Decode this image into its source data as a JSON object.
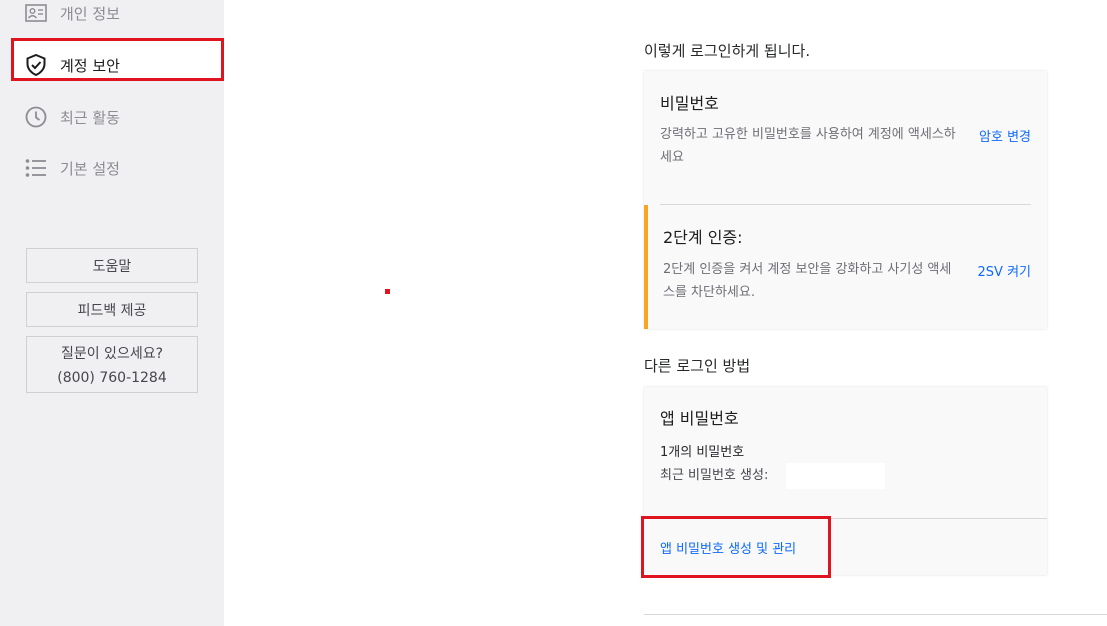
{
  "sidebar": {
    "items": [
      {
        "label": "개인 정보",
        "icon": "id-card-icon"
      },
      {
        "label": "계정 보안",
        "icon": "shield-check-icon",
        "active": true
      },
      {
        "label": "최근 활동",
        "icon": "clock-icon"
      },
      {
        "label": "기본 설정",
        "icon": "list-icon"
      }
    ],
    "help_label": "도움말",
    "feedback_label": "피드백 제공",
    "contact": {
      "question": "질문이 있으세요?",
      "phone": "(800) 760-1284"
    }
  },
  "main": {
    "signin_title": "이렇게 로그인하게 됩니다.",
    "password": {
      "title": "비밀번호",
      "description": "강력하고 고유한 비밀번호를 사용하여 계정에 액세스하세요",
      "link": "암호 변경"
    },
    "two_step": {
      "title": "2단계 인증:",
      "description": "2단계 인증을 켜서 계정 보안을 강화하고 사기성 액세스를 차단하세요.",
      "link": "2SV 켜기"
    },
    "other_title": "다른 로그인 방법",
    "app_password": {
      "title": "앱 비밀번호",
      "count": "1개의 비밀번호",
      "recent_label": "최근 비밀번호 생성:",
      "manage_link": "앱 비밀번호 생성 및 관리"
    }
  },
  "colors": {
    "highlight": "#e0141e",
    "link": "#0f69ff",
    "warning_bar": "#f5a623",
    "sidebar_bg": "#f0f0f3"
  }
}
